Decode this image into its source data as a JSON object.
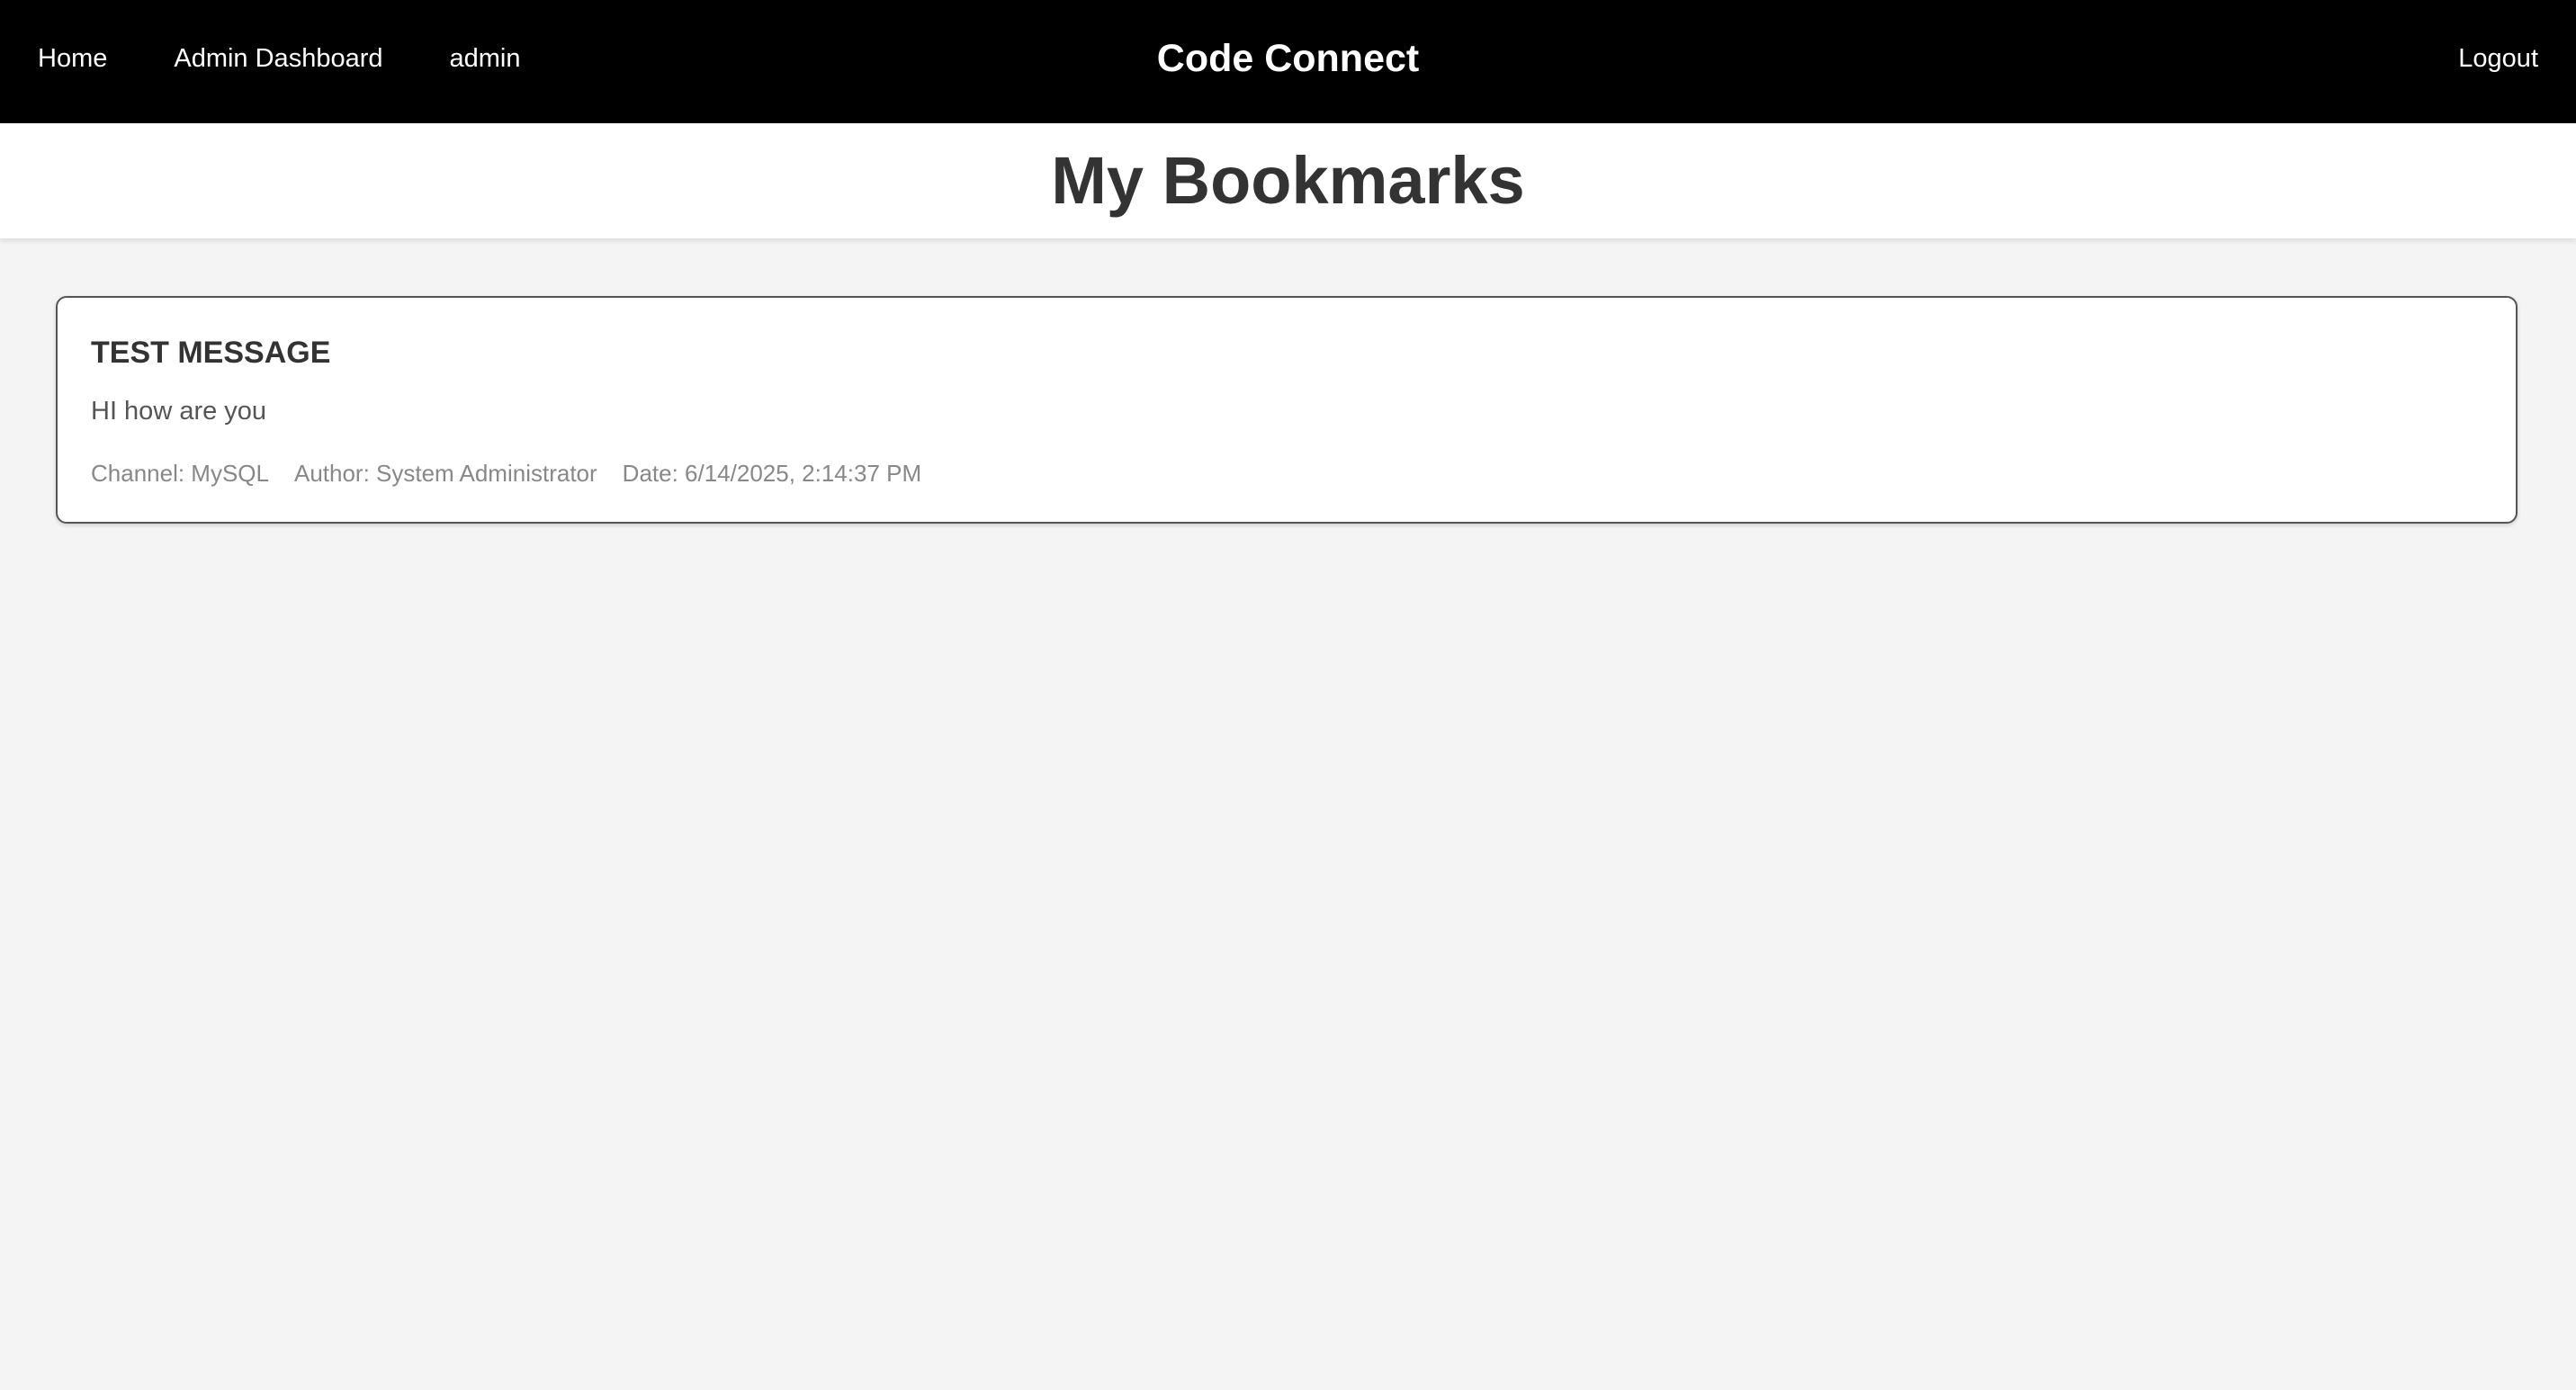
{
  "nav": {
    "home": "Home",
    "admin_dashboard": "Admin Dashboard",
    "user": "admin",
    "brand": "Code Connect",
    "logout": "Logout"
  },
  "page": {
    "title": "My Bookmarks"
  },
  "bookmarks": [
    {
      "title": "TEST MESSAGE",
      "body": "HI how are you",
      "channel": "Channel: MySQL",
      "author": "Author: System Administrator",
      "date": "Date: 6/14/2025, 2:14:37 PM"
    }
  ],
  "colors": {
    "navbar_bg": "#000000",
    "page_bg": "#f4f4f4",
    "card_bg": "#ffffff",
    "title_text": "#333333",
    "meta_text": "#888888"
  }
}
